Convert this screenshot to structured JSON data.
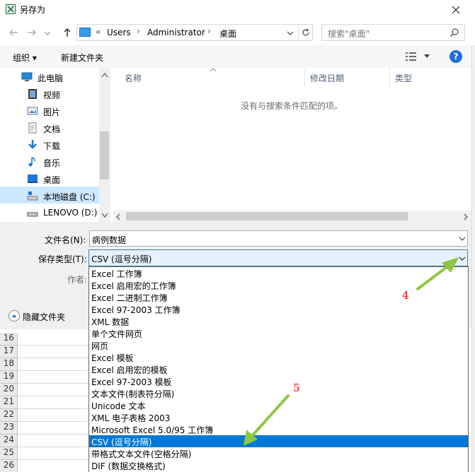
{
  "window": {
    "title": "另存为"
  },
  "address": {
    "crumbs": [
      "Users",
      "Administrator",
      "桌面"
    ],
    "overflow_marker": "«",
    "search_placeholder": "搜索\"桌面\""
  },
  "toolbar": {
    "organize_label": "组织 ▾",
    "new_folder_label": "新建文件夹"
  },
  "nav_items": [
    {
      "label": "此电脑",
      "icon": "computer-icon"
    },
    {
      "label": "视频",
      "icon": "video-icon"
    },
    {
      "label": "图片",
      "icon": "pictures-icon"
    },
    {
      "label": "文档",
      "icon": "documents-icon"
    },
    {
      "label": "下载",
      "icon": "download-icon"
    },
    {
      "label": "音乐",
      "icon": "music-icon"
    },
    {
      "label": "桌面",
      "icon": "desktop-icon"
    },
    {
      "label": "本地磁盘 (C:)",
      "icon": "drive-icon"
    },
    {
      "label": "LENOVO (D:)",
      "icon": "drive-icon"
    }
  ],
  "columns": {
    "name": "名称",
    "modified": "修改日期",
    "type": "类型"
  },
  "empty_message": "没有与搜索条件匹配的项。",
  "form": {
    "filename_label": "文件名(N):",
    "filename_value": "病例数据",
    "savetype_label": "保存类型(T):",
    "savetype_value": "CSV (逗号分隔)",
    "author_label": "作者:",
    "hide_folders_label": "隐藏文件夹"
  },
  "save_types": [
    "Excel 工作簿",
    "Excel 启用宏的工作簿",
    "Excel 二进制工作簿",
    "Excel 97-2003 工作簿",
    "XML 数据",
    "单个文件网页",
    "网页",
    "Excel 模板",
    "Excel 启用宏的模板",
    "Excel 97-2003 模板",
    "文本文件(制表符分隔)",
    "Unicode 文本",
    "XML 电子表格 2003",
    "Microsoft Excel 5.0/95 工作簿",
    "CSV (逗号分隔)",
    "带格式文本文件(空格分隔)",
    "DIF (数据交换格式)"
  ],
  "selected_type": "CSV (逗号分隔)",
  "excel_row_numbers": [
    "16",
    "17",
    "18",
    "19",
    "20",
    "21",
    "22",
    "23",
    "24",
    "25",
    "26"
  ],
  "annotations": {
    "step4": "4",
    "step5": "5"
  },
  "colors": {
    "accent": "#0078d7",
    "arrow": "#8dc63f",
    "annotation": "#ff0000"
  }
}
